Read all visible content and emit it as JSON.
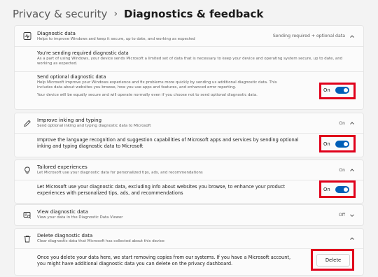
{
  "header": {
    "breadcrumb": "Privacy & security",
    "separator": "›",
    "title": "Diagnostics & feedback"
  },
  "sections": {
    "diagnostic_data": {
      "title": "Diagnostic data",
      "desc": "Helps to improve Windows and keep it secure, up to date, and working as expected",
      "status": "Sending required + optional data",
      "icon": "diagnostic-data-icon",
      "required": {
        "title": "You're sending required diagnostic data",
        "desc": "As a part of using Windows, your device sends Microsoft a limited set of data that is necessary to keep your device and operating system secure, up to date, and working as expected."
      },
      "optional": {
        "title": "Send optional diagnostic data",
        "desc": "Help Microsoft improve your Windows experience and fix problems more quickly by sending us additional diagnostic data. This includes data about websites you browse, how you use apps and features, and enhanced error reporting.",
        "note": "Your device will be equally secure and will operate normally even if you choose not to send optional diagnostic data.",
        "toggle_label": "On"
      }
    },
    "inking": {
      "title": "Improve inking and typing",
      "desc": "Send optional inking and typing diagnostic data to Microsoft",
      "status": "On",
      "icon": "pen-icon",
      "sub": {
        "text": "Improve the language recognition and suggestion capabilities of Microsoft apps and services by sending optional inking and typing diagnostic data to Microsoft",
        "toggle_label": "On"
      }
    },
    "tailored": {
      "title": "Tailored experiences",
      "desc": "Let Microsoft use your diagnostic data for personalized tips, ads, and recommendations",
      "status": "On",
      "icon": "lightbulb-icon",
      "sub": {
        "text": "Let Microsoft use your diagnostic data, excluding info about websites you browse, to enhance your product experiences with personalized tips, ads, and recommendations",
        "toggle_label": "On"
      }
    },
    "viewer": {
      "title": "View diagnostic data",
      "desc": "View your data in the Diagnostic Data Viewer",
      "status": "Off",
      "icon": "data-viewer-icon"
    },
    "delete": {
      "title": "Delete diagnostic data",
      "desc": "Clear diagnostic data that Microsoft has collected about this device",
      "icon": "trash-icon",
      "sub": {
        "text": "Once you delete your data here, we start removing copies from our systems. If you have a Microsoft account, you might have additional diagnostic data you can delete on the privacy dashboard.",
        "button_label": "Delete"
      }
    }
  },
  "colors": {
    "accent": "#005fb8",
    "highlight": "#e0001b"
  }
}
